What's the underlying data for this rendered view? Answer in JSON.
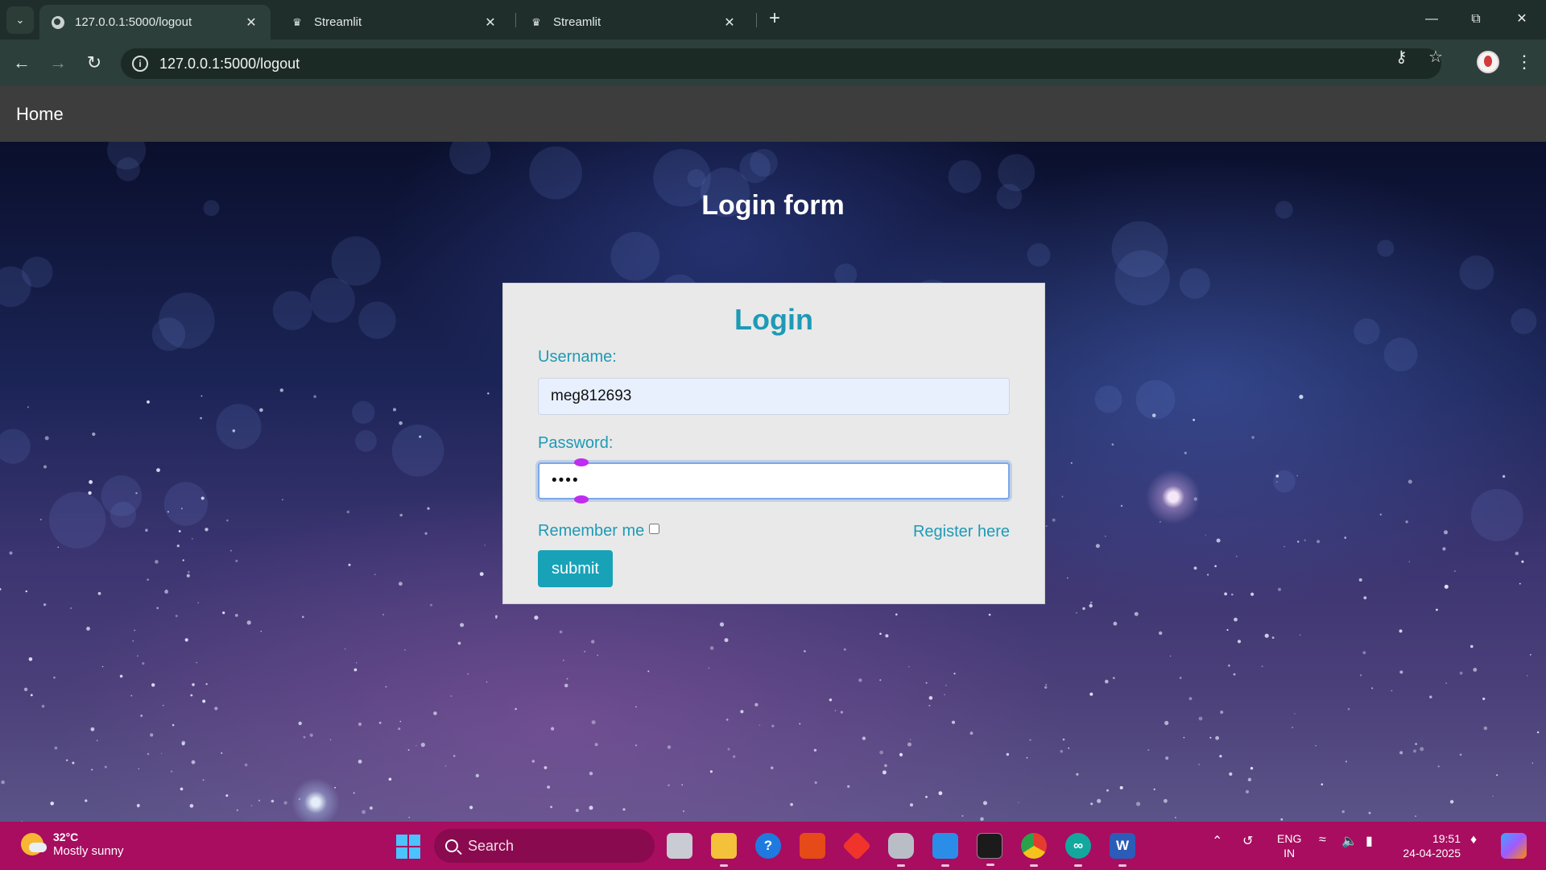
{
  "browser": {
    "tabs": [
      {
        "title": "127.0.0.1:5000/logout",
        "active": true,
        "icon": "globe-icon"
      },
      {
        "title": "Streamlit",
        "active": false,
        "icon": "streamlit-crown-icon"
      },
      {
        "title": "Streamlit",
        "active": false,
        "icon": "streamlit-crown-icon"
      }
    ],
    "url": "127.0.0.1:5000/logout"
  },
  "navbar": {
    "home_label": "Home"
  },
  "page": {
    "title": "Login form"
  },
  "login": {
    "heading": "Login",
    "username_label": "Username:",
    "username_value": "meg812693",
    "password_label": "Password:",
    "password_value": "••••",
    "remember_label": "Remember me",
    "register_label": "Register here",
    "submit_label": "submit"
  },
  "taskbar": {
    "weather_temp": "32°C",
    "weather_desc": "Mostly sunny",
    "search_placeholder": "Search",
    "lang_line1": "ENG",
    "lang_line2": "IN",
    "time": "19:51",
    "date": "24-04-2025"
  },
  "colors": {
    "accent": "#1e9ab6",
    "submit": "#17a2b8",
    "taskbar": "#a80d60",
    "navbar": "#3d3d3d"
  }
}
